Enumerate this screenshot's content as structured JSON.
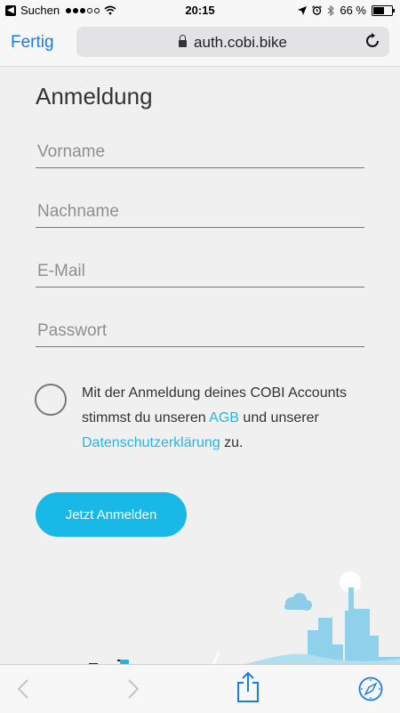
{
  "status_bar": {
    "carrier_back": "Suchen",
    "time": "20:15",
    "battery_percent": "66 %",
    "battery_level": 0.66
  },
  "browser": {
    "done_label": "Fertig",
    "url": "auth.cobi.bike"
  },
  "form": {
    "title": "Anmeldung",
    "fields": [
      {
        "placeholder": "Vorname",
        "value": ""
      },
      {
        "placeholder": "Nachname",
        "value": ""
      },
      {
        "placeholder": "E-Mail",
        "value": ""
      },
      {
        "placeholder": "Passwort",
        "value": ""
      }
    ],
    "terms": {
      "text_1": "Mit der Anmeldung deines COBI Accounts stimmst du unseren ",
      "link_agb": "AGB",
      "text_2": " und unserer ",
      "link_privacy": "Datenschutzerklärung",
      "text_3": " zu.",
      "checked": false
    },
    "submit_label": "Jetzt Anmelden"
  },
  "colors": {
    "accent": "#18b9e6",
    "link": "#25b7e0",
    "ios_blue": "#1a7ee0",
    "background": "#f0f0f0"
  },
  "toolbar": {
    "icons": [
      "back-arrow-icon",
      "forward-arrow-icon",
      "share-icon",
      "compass-icon"
    ]
  }
}
